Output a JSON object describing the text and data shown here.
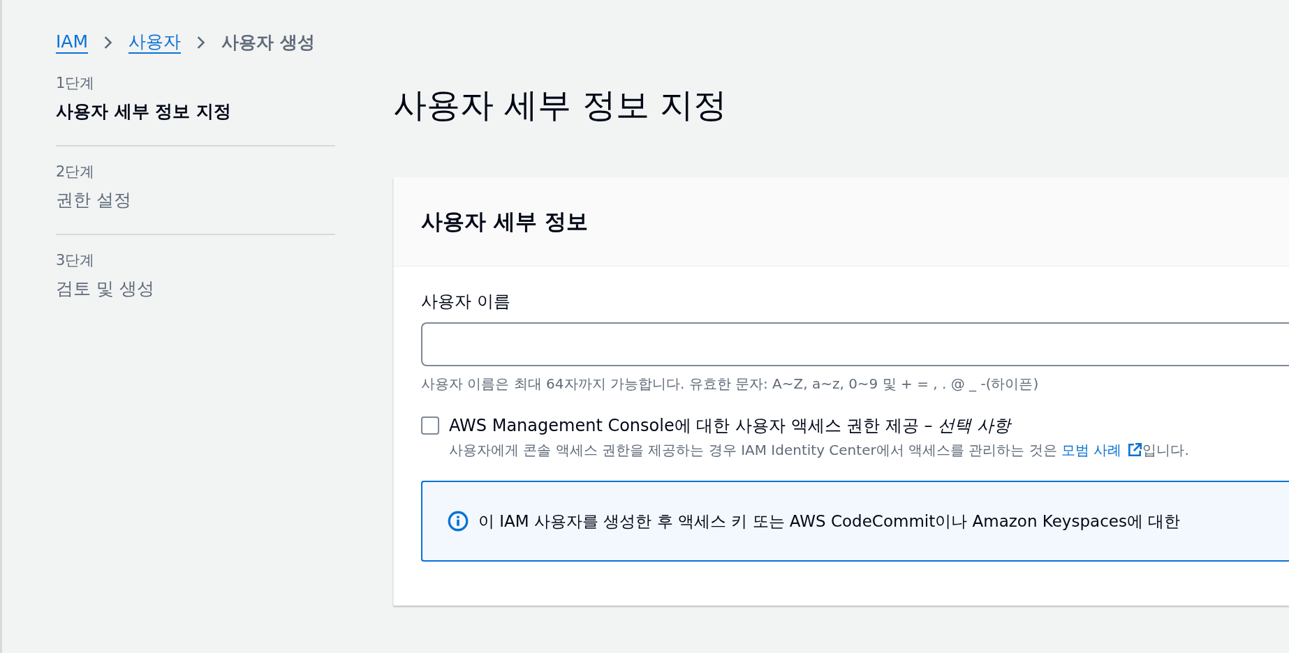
{
  "breadcrumb": [
    {
      "label": "IAM",
      "kind": "link"
    },
    {
      "label": "사용자",
      "kind": "link"
    },
    {
      "label": "사용자 생성",
      "kind": "current"
    }
  ],
  "steps": [
    {
      "step": "1단계",
      "title": "사용자 세부 정보 지정",
      "selected": true
    },
    {
      "step": "2단계",
      "title": "권한 설정",
      "selected": false
    },
    {
      "step": "3단계",
      "title": "검토 및 생성",
      "selected": false
    }
  ],
  "page_title": "사용자 세부 정보 지정",
  "card": {
    "title": "사용자 세부 정보",
    "username_field": {
      "label": "사용자 이름",
      "helper": "사용자 이름은 최대 64자까지 가능합니다. 유효한 문자: A~Z, a~z, 0~9 및 + = , . @ _ -(하이픈)"
    },
    "console_access": {
      "checked": false,
      "label": "AWS Management Console에 대한 사용자 액세스 권한 제공 – *선택 사항*",
      "description_before": "사용자에게 콘솔 액세스 권한을 제공하는 경우 IAM Identity Center에서 액세스를 관리하는 것은 ",
      "link": "모범 사례",
      "description_after": "입니다."
    },
    "info": "이 IAM 사용자를 생성한 후 액세스 키 또는 AWS CodeCommit이나 Amazon Keyspaces에 대한"
  }
}
